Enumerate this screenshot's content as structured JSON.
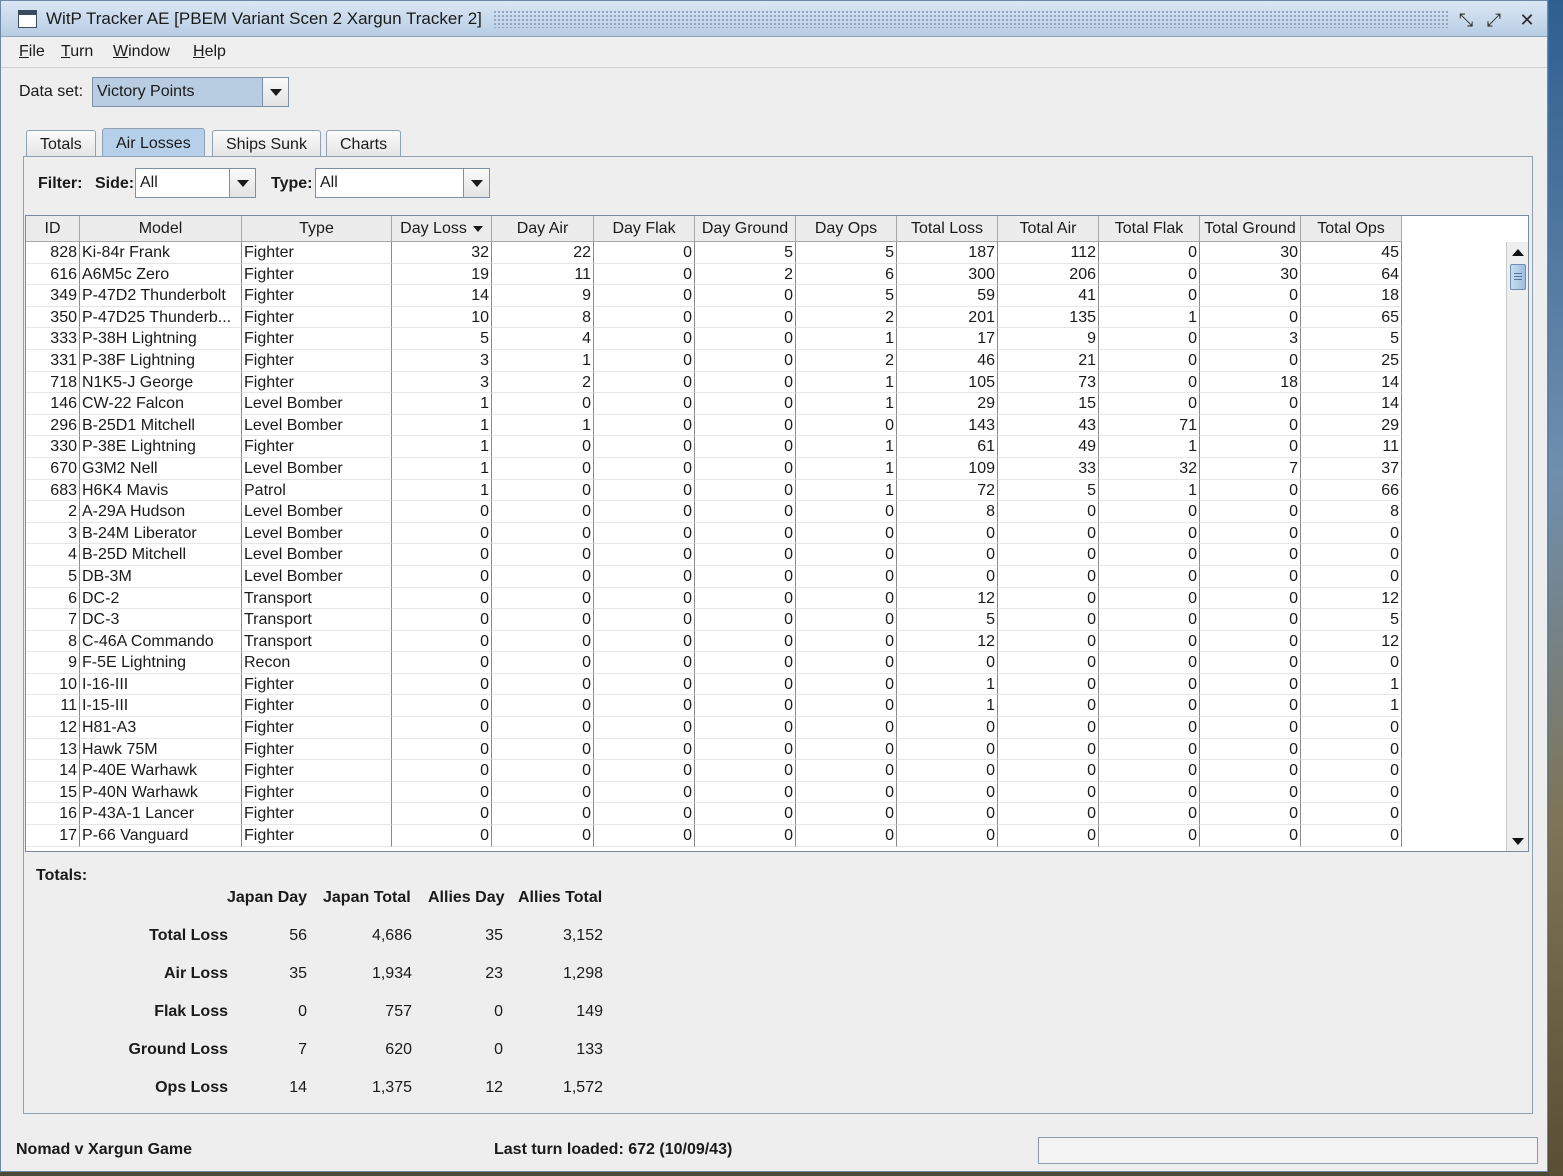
{
  "window": {
    "title": "WitP Tracker AE [PBEM Variant Scen 2 Xargun Tracker 2]",
    "minimize_glyph": "⤡",
    "maximize_glyph": "⤢",
    "close_glyph": "✕"
  },
  "menu": {
    "items": [
      "File",
      "Turn",
      "Window",
      "Help"
    ]
  },
  "dataset": {
    "label": "Data set:",
    "value": "Victory Points"
  },
  "tabs": [
    {
      "label": "Totals",
      "selected": false
    },
    {
      "label": "Air Losses",
      "selected": true
    },
    {
      "label": "Ships Sunk",
      "selected": false
    },
    {
      "label": "Charts",
      "selected": false
    }
  ],
  "filter": {
    "label": "Filter:",
    "side_label": "Side:",
    "side_value": "All",
    "type_label": "Type:",
    "type_value": "All"
  },
  "table": {
    "columns": [
      "ID",
      "Model",
      "Type",
      "Day Loss",
      "Day Air",
      "Day Flak",
      "Day Ground",
      "Day Ops",
      "Total Loss",
      "Total Air",
      "Total Flak",
      "Total Ground",
      "Total Ops"
    ],
    "sorted_column": "Day Loss",
    "rows": [
      [
        "828",
        "Ki-84r Frank",
        "Fighter",
        "32",
        "22",
        "0",
        "5",
        "5",
        "187",
        "112",
        "0",
        "30",
        "45"
      ],
      [
        "616",
        "A6M5c Zero",
        "Fighter",
        "19",
        "11",
        "0",
        "2",
        "6",
        "300",
        "206",
        "0",
        "30",
        "64"
      ],
      [
        "349",
        "P-47D2 Thunderbolt",
        "Fighter",
        "14",
        "9",
        "0",
        "0",
        "5",
        "59",
        "41",
        "0",
        "0",
        "18"
      ],
      [
        "350",
        "P-47D25 Thunderb...",
        "Fighter",
        "10",
        "8",
        "0",
        "0",
        "2",
        "201",
        "135",
        "1",
        "0",
        "65"
      ],
      [
        "333",
        "P-38H Lightning",
        "Fighter",
        "5",
        "4",
        "0",
        "0",
        "1",
        "17",
        "9",
        "0",
        "3",
        "5"
      ],
      [
        "331",
        "P-38F Lightning",
        "Fighter",
        "3",
        "1",
        "0",
        "0",
        "2",
        "46",
        "21",
        "0",
        "0",
        "25"
      ],
      [
        "718",
        "N1K5-J George",
        "Fighter",
        "3",
        "2",
        "0",
        "0",
        "1",
        "105",
        "73",
        "0",
        "18",
        "14"
      ],
      [
        "146",
        "CW-22 Falcon",
        "Level Bomber",
        "1",
        "0",
        "0",
        "0",
        "1",
        "29",
        "15",
        "0",
        "0",
        "14"
      ],
      [
        "296",
        "B-25D1 Mitchell",
        "Level Bomber",
        "1",
        "1",
        "0",
        "0",
        "0",
        "143",
        "43",
        "71",
        "0",
        "29"
      ],
      [
        "330",
        "P-38E Lightning",
        "Fighter",
        "1",
        "0",
        "0",
        "0",
        "1",
        "61",
        "49",
        "1",
        "0",
        "11"
      ],
      [
        "670",
        "G3M2 Nell",
        "Level Bomber",
        "1",
        "0",
        "0",
        "0",
        "1",
        "109",
        "33",
        "32",
        "7",
        "37"
      ],
      [
        "683",
        "H6K4 Mavis",
        "Patrol",
        "1",
        "0",
        "0",
        "0",
        "1",
        "72",
        "5",
        "1",
        "0",
        "66"
      ],
      [
        "2",
        "A-29A Hudson",
        "Level Bomber",
        "0",
        "0",
        "0",
        "0",
        "0",
        "8",
        "0",
        "0",
        "0",
        "8"
      ],
      [
        "3",
        "B-24M Liberator",
        "Level Bomber",
        "0",
        "0",
        "0",
        "0",
        "0",
        "0",
        "0",
        "0",
        "0",
        "0"
      ],
      [
        "4",
        "B-25D Mitchell",
        "Level Bomber",
        "0",
        "0",
        "0",
        "0",
        "0",
        "0",
        "0",
        "0",
        "0",
        "0"
      ],
      [
        "5",
        "DB-3M",
        "Level Bomber",
        "0",
        "0",
        "0",
        "0",
        "0",
        "0",
        "0",
        "0",
        "0",
        "0"
      ],
      [
        "6",
        "DC-2",
        "Transport",
        "0",
        "0",
        "0",
        "0",
        "0",
        "12",
        "0",
        "0",
        "0",
        "12"
      ],
      [
        "7",
        "DC-3",
        "Transport",
        "0",
        "0",
        "0",
        "0",
        "0",
        "5",
        "0",
        "0",
        "0",
        "5"
      ],
      [
        "8",
        "C-46A Commando",
        "Transport",
        "0",
        "0",
        "0",
        "0",
        "0",
        "12",
        "0",
        "0",
        "0",
        "12"
      ],
      [
        "9",
        "F-5E Lightning",
        "Recon",
        "0",
        "0",
        "0",
        "0",
        "0",
        "0",
        "0",
        "0",
        "0",
        "0"
      ],
      [
        "10",
        "I-16-III",
        "Fighter",
        "0",
        "0",
        "0",
        "0",
        "0",
        "1",
        "0",
        "0",
        "0",
        "1"
      ],
      [
        "11",
        "I-15-III",
        "Fighter",
        "0",
        "0",
        "0",
        "0",
        "0",
        "1",
        "0",
        "0",
        "0",
        "1"
      ],
      [
        "12",
        "H81-A3",
        "Fighter",
        "0",
        "0",
        "0",
        "0",
        "0",
        "0",
        "0",
        "0",
        "0",
        "0"
      ],
      [
        "13",
        "Hawk 75M",
        "Fighter",
        "0",
        "0",
        "0",
        "0",
        "0",
        "0",
        "0",
        "0",
        "0",
        "0"
      ],
      [
        "14",
        "P-40E Warhawk",
        "Fighter",
        "0",
        "0",
        "0",
        "0",
        "0",
        "0",
        "0",
        "0",
        "0",
        "0"
      ],
      [
        "15",
        "P-40N Warhawk",
        "Fighter",
        "0",
        "0",
        "0",
        "0",
        "0",
        "0",
        "0",
        "0",
        "0",
        "0"
      ],
      [
        "16",
        "P-43A-1 Lancer",
        "Fighter",
        "0",
        "0",
        "0",
        "0",
        "0",
        "0",
        "0",
        "0",
        "0",
        "0"
      ],
      [
        "17",
        "P-66 Vanguard",
        "Fighter",
        "0",
        "0",
        "0",
        "0",
        "0",
        "0",
        "0",
        "0",
        "0",
        "0"
      ]
    ]
  },
  "totals": {
    "title": "Totals:",
    "columns": [
      "Japan Day",
      "Japan Total",
      "Allies Day",
      "Allies Total"
    ],
    "rows": [
      {
        "label": "Total Loss",
        "values": [
          "56",
          "4,686",
          "35",
          "3,152"
        ]
      },
      {
        "label": "Air Loss",
        "values": [
          "35",
          "1,934",
          "23",
          "1,298"
        ]
      },
      {
        "label": "Flak Loss",
        "values": [
          "0",
          "757",
          "0",
          "149"
        ]
      },
      {
        "label": "Ground Loss",
        "values": [
          "7",
          "620",
          "0",
          "133"
        ]
      },
      {
        "label": "Ops Loss",
        "values": [
          "14",
          "1,375",
          "12",
          "1,572"
        ]
      }
    ]
  },
  "status": {
    "game": "Nomad v Xargun Game",
    "last_turn": "Last turn loaded: 672 (10/09/43)"
  }
}
